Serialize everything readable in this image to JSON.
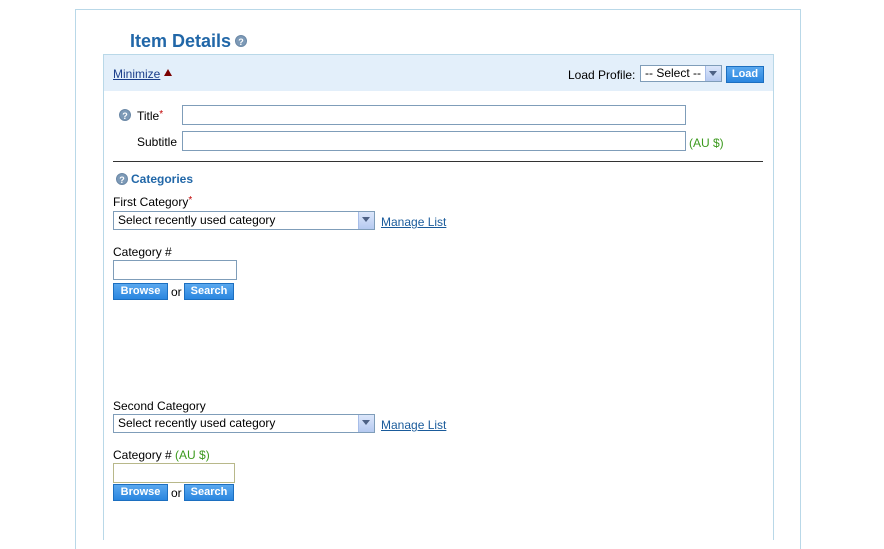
{
  "header": {
    "title": "Item Details",
    "help_icon": "question-circle-icon"
  },
  "toolbar": {
    "minimize_label": "Minimize",
    "load_profile_label": "Load Profile:",
    "profile_select_value": "-- Select --",
    "load_button": "Load"
  },
  "fields": {
    "title_label": "Title",
    "required_mark": "*",
    "subtitle_label": "Subtitle",
    "subtitle_currency": "(AU $)",
    "title_value": "",
    "subtitle_value": ""
  },
  "categories": {
    "heading": "Categories",
    "first": {
      "label": "First Category",
      "required_mark": "*",
      "select_value": "Select recently used category",
      "manage_link": "Manage List",
      "number_label": "Category #",
      "number_value": "",
      "browse_button": "Browse",
      "or_text": "or",
      "search_button": "Search"
    },
    "second": {
      "label": "Second Category",
      "select_value": "Select recently used category",
      "manage_link": "Manage List",
      "number_label": "Category #",
      "number_currency": "(AU $)",
      "number_value": "",
      "browse_button": "Browse",
      "or_text": "or",
      "search_button": "Search"
    }
  },
  "colors": {
    "accent_blue": "#2167a8",
    "button_blue": "#2a86e0",
    "toolbar_bg": "#e3effa",
    "currency_green": "#3c9a1e",
    "required_red": "#c00000"
  }
}
